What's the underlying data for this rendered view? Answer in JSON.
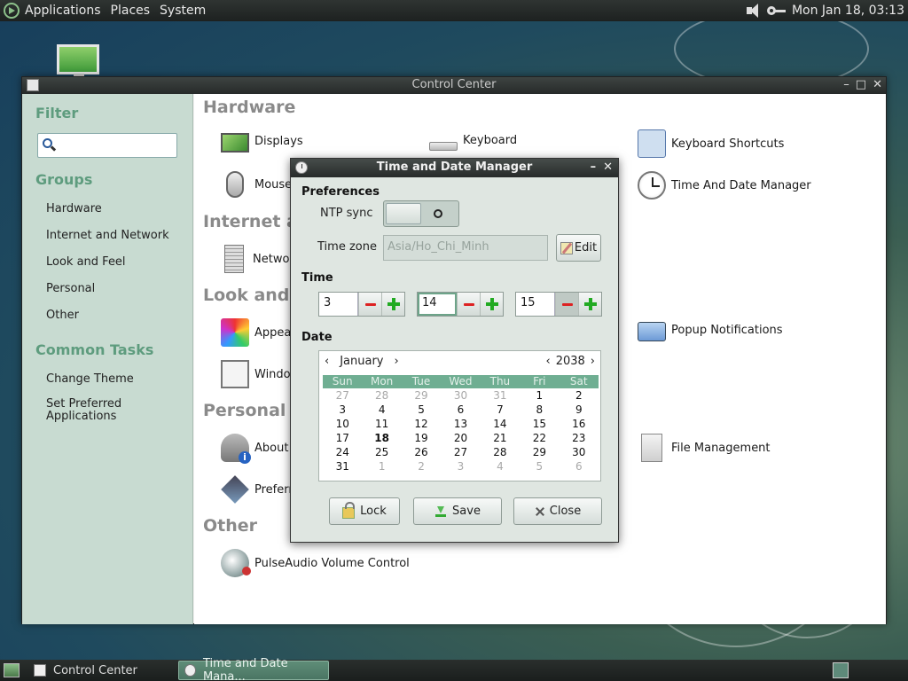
{
  "top_panel": {
    "menus": [
      "Applications",
      "Places",
      "System"
    ],
    "clock": "Mon Jan 18, 03:13"
  },
  "control_center": {
    "title": "Control Center",
    "sidebar": {
      "filter_heading": "Filter",
      "filter_value": "",
      "groups_heading": "Groups",
      "groups": [
        "Hardware",
        "Internet and Network",
        "Look and Feel",
        "Personal",
        "Other"
      ],
      "tasks_heading": "Common Tasks",
      "tasks": [
        "Change Theme",
        "Set Preferred Applications"
      ]
    },
    "categories": {
      "hardware": "Hardware",
      "internet": "Internet and Network",
      "look": "Look and Feel",
      "personal": "Personal",
      "other": "Other"
    },
    "items": {
      "displays": "Displays",
      "keyboard": "Keyboard",
      "keyboard_shortcuts": "Keyboard Shortcuts",
      "mouse": "Mouse",
      "time_date": "Time And Date Manager",
      "network": "Network",
      "appearance": "Appearance",
      "popup": "Popup Notifications",
      "windows": "Windows",
      "about_me": "About Me",
      "file_management": "File Management",
      "preferred": "Preferred Applications",
      "pulseaudio": "PulseAudio Volume Control"
    }
  },
  "dialog": {
    "title": "Time and Date Manager",
    "preferences_label": "Preferences",
    "ntp_label": "NTP sync",
    "ntp_enabled": false,
    "timezone_label": "Time zone",
    "timezone_value": "Asia/Ho_Chi_Minh",
    "edit_label": "Edit",
    "time_label": "Time",
    "hour": "3",
    "minute": "14",
    "second": "15",
    "date_label": "Date",
    "calendar": {
      "month": "January",
      "year": "2038",
      "weekdays": [
        "Sun",
        "Mon",
        "Tue",
        "Wed",
        "Thu",
        "Fri",
        "Sat"
      ],
      "days": [
        {
          "d": "27",
          "other": true
        },
        {
          "d": "28",
          "other": true
        },
        {
          "d": "29",
          "other": true
        },
        {
          "d": "30",
          "other": true
        },
        {
          "d": "31",
          "other": true
        },
        {
          "d": "1"
        },
        {
          "d": "2"
        },
        {
          "d": "3"
        },
        {
          "d": "4"
        },
        {
          "d": "5"
        },
        {
          "d": "6"
        },
        {
          "d": "7"
        },
        {
          "d": "8"
        },
        {
          "d": "9"
        },
        {
          "d": "10"
        },
        {
          "d": "11"
        },
        {
          "d": "12"
        },
        {
          "d": "13"
        },
        {
          "d": "14"
        },
        {
          "d": "15"
        },
        {
          "d": "16"
        },
        {
          "d": "17"
        },
        {
          "d": "18",
          "today": true
        },
        {
          "d": "19"
        },
        {
          "d": "20"
        },
        {
          "d": "21"
        },
        {
          "d": "22"
        },
        {
          "d": "23"
        },
        {
          "d": "24"
        },
        {
          "d": "25"
        },
        {
          "d": "26"
        },
        {
          "d": "27"
        },
        {
          "d": "28"
        },
        {
          "d": "29"
        },
        {
          "d": "30"
        },
        {
          "d": "31"
        },
        {
          "d": "1",
          "other": true
        },
        {
          "d": "2",
          "other": true
        },
        {
          "d": "3",
          "other": true
        },
        {
          "d": "4",
          "other": true
        },
        {
          "d": "5",
          "other": true
        },
        {
          "d": "6",
          "other": true
        }
      ]
    },
    "lock_label": "Lock",
    "save_label": "Save",
    "close_label": "Close"
  },
  "taskbar": {
    "tasks": [
      "Control Center",
      "Time and Date Mana..."
    ]
  },
  "colors": {
    "sidebar_bg": "#c8dbd1",
    "accent": "#6fae92",
    "dialog_bg": "#dfe6e1"
  }
}
